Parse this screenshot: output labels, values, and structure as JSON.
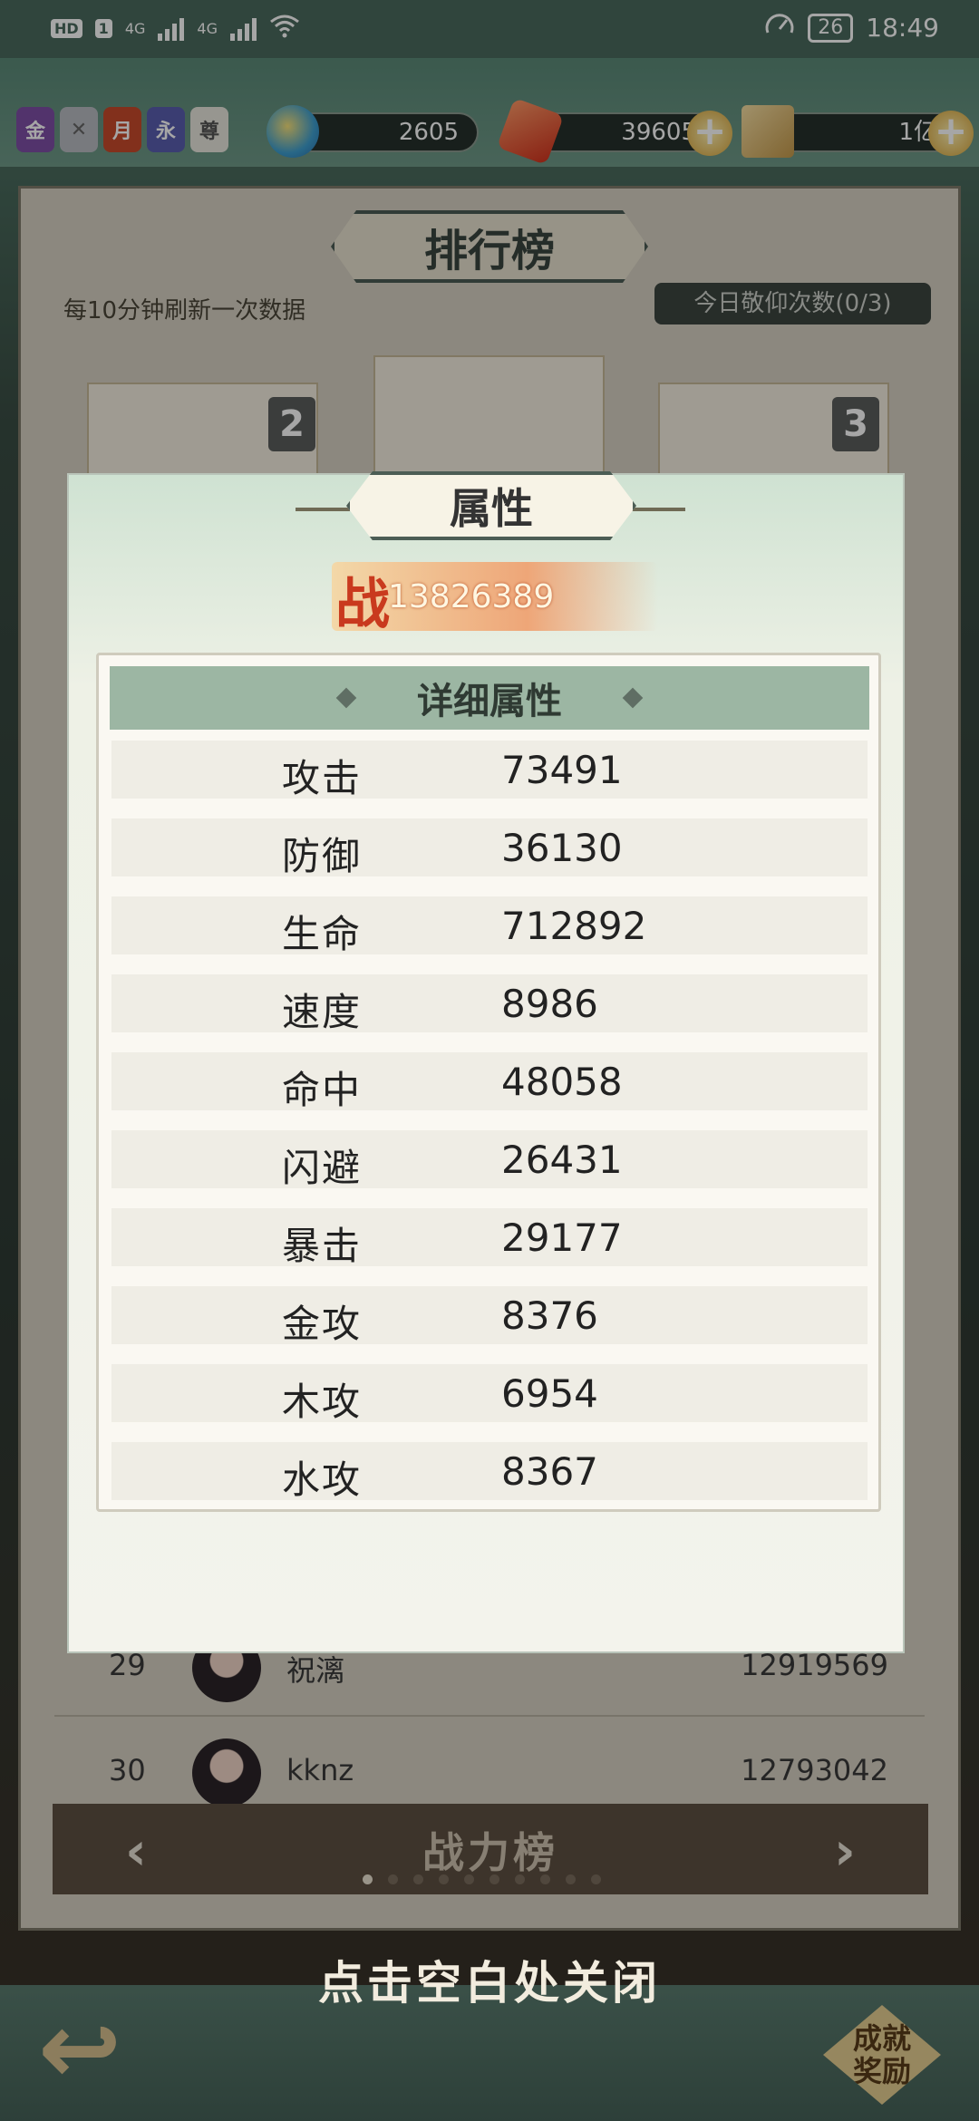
{
  "status_bar": {
    "hd_tag": "HD",
    "sim1_tag": "1",
    "net1": "4G",
    "net2": "4G",
    "battery": "26",
    "time": "18:49"
  },
  "top_bar": {
    "badges": [
      {
        "label": "金",
        "color": "#7e4fa6"
      },
      {
        "label": "",
        "color": "#b9bcc2"
      },
      {
        "label": "月",
        "color": "#c84b2c"
      },
      {
        "label": "永",
        "color": "#5a5fb0"
      },
      {
        "label": "尊",
        "color": "#e8e6de"
      }
    ],
    "currency_1": "2605",
    "currency_2": "39605",
    "currency_3": "1亿"
  },
  "leaderboard": {
    "title": "排行榜",
    "refresh_note": "每10分钟刷新一次数据",
    "worship_label": "今日敬仰次数(0/3)",
    "podium_ranks": [
      "2",
      "3"
    ],
    "rows": [
      {
        "rank": "29",
        "name": "祝漓",
        "score": "12919569"
      },
      {
        "rank": "30",
        "name": "kknz",
        "score": "12793042"
      }
    ],
    "footer_label": "战力榜",
    "close_tip": "点击空白处关闭",
    "achievement_label_1": "成就",
    "achievement_label_2": "奖励"
  },
  "modal": {
    "title": "属性",
    "power_prefix": "战",
    "power_value": "13826389",
    "section_title": "详细属性",
    "attributes": [
      {
        "name": "攻击",
        "value": "73491"
      },
      {
        "name": "防御",
        "value": "36130"
      },
      {
        "name": "生命",
        "value": "712892"
      },
      {
        "name": "速度",
        "value": "8986"
      },
      {
        "name": "命中",
        "value": "48058"
      },
      {
        "name": "闪避",
        "value": "26431"
      },
      {
        "name": "暴击",
        "value": "29177"
      },
      {
        "name": "金攻",
        "value": "8376"
      },
      {
        "name": "木攻",
        "value": "6954"
      },
      {
        "name": "水攻",
        "value": "8367"
      }
    ]
  }
}
